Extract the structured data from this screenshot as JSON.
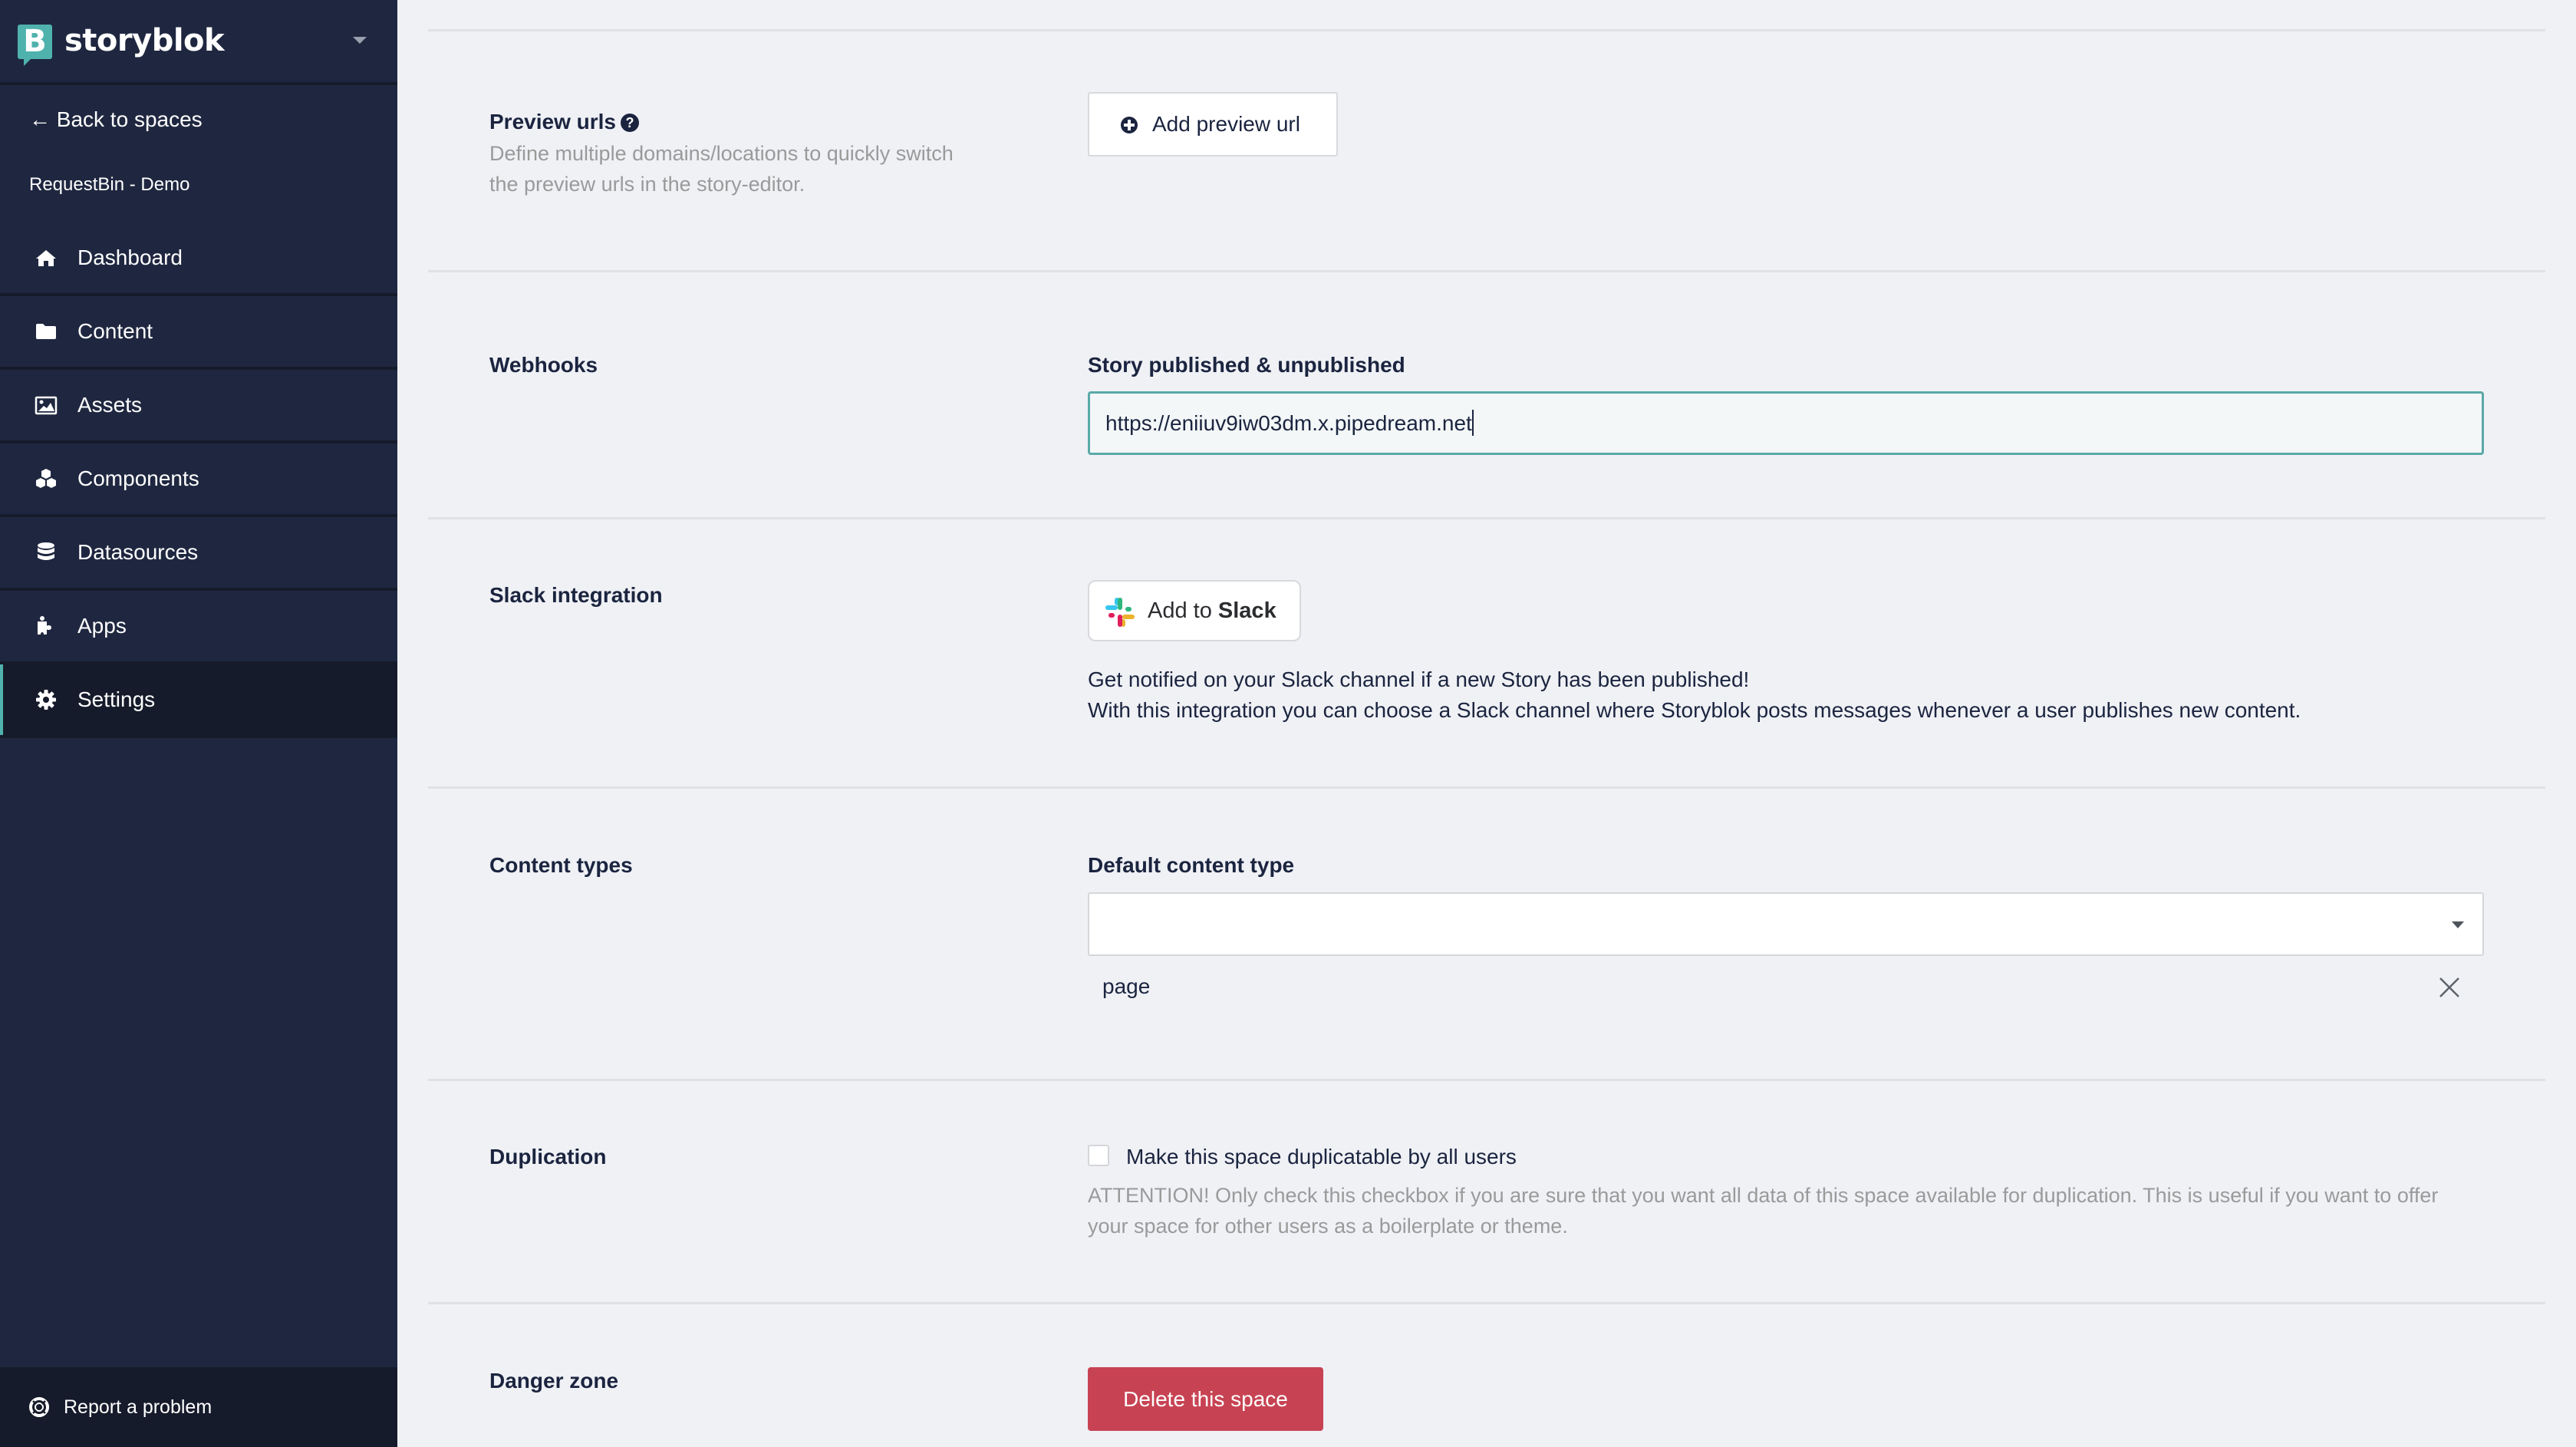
{
  "app": {
    "brand": "storyblok",
    "logo_letter": "B"
  },
  "sidebar": {
    "back_label": "← Back to spaces",
    "space_name": "RequestBin - Demo",
    "items": [
      {
        "label": "Dashboard",
        "icon": "home-icon",
        "active": false
      },
      {
        "label": "Content",
        "icon": "folder-icon",
        "active": false
      },
      {
        "label": "Assets",
        "icon": "image-icon",
        "active": false
      },
      {
        "label": "Components",
        "icon": "cubes-icon",
        "active": false
      },
      {
        "label": "Datasources",
        "icon": "database-icon",
        "active": false
      },
      {
        "label": "Apps",
        "icon": "puzzle-icon",
        "active": false
      },
      {
        "label": "Settings",
        "icon": "gear-icon",
        "active": true
      }
    ],
    "footer_label": "Report a problem",
    "accent_color": "#4fb2ad"
  },
  "sections": {
    "preview_urls": {
      "label": "Preview urls",
      "help_glyph": "?",
      "description": "Define multiple domains/locations to quickly switch the preview urls in the story-editor.",
      "button_label": "Add preview url"
    },
    "webhooks": {
      "label": "Webhooks",
      "field_label": "Story published & unpublished",
      "value": "https://eniiuv9iw03dm.x.pipedream.net"
    },
    "slack": {
      "label": "Slack integration",
      "button_prefix": "Add to ",
      "button_brand": "Slack",
      "line1": "Get notified on your Slack channel if a new Story has been published!",
      "line2": "With this integration you can choose a Slack channel where Storyblok posts messages whenever a user publishes new content."
    },
    "content_types": {
      "label": "Content types",
      "field_label": "Default content type",
      "selected": "",
      "tags": [
        "page"
      ]
    },
    "duplication": {
      "label": "Duplication",
      "checkbox_label": "Make this space duplicatable by all users",
      "checked": false,
      "warning": "ATTENTION! Only check this checkbox if you are sure that you want all data of this space available for duplication. This is useful if you want to offer your space for other users as a boilerplate or theme."
    },
    "danger_zone": {
      "label": "Danger zone",
      "button_label": "Delete this space",
      "button_color": "#c74353"
    }
  }
}
